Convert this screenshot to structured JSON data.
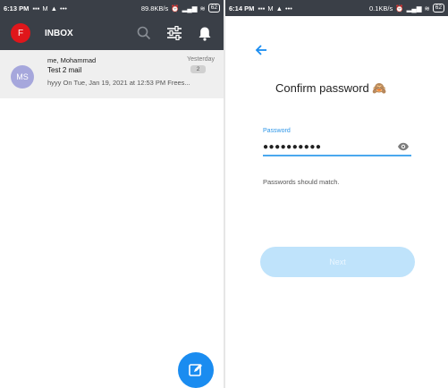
{
  "left": {
    "status": {
      "time": "6:13 PM",
      "speed": "89.8KB/s",
      "battery": "62"
    },
    "header": {
      "avatar": "F",
      "title": "INBOX"
    },
    "mail": {
      "avatar": "MS",
      "from": "me, Mohammad",
      "date": "Yesterday",
      "subject": "Test 2 mail",
      "count": "2",
      "snippet": "hyyy On Tue, Jan 19, 2021 at 12:53 PM Frees..."
    }
  },
  "right": {
    "status": {
      "time": "6:14 PM",
      "speed": "0.1KB/s",
      "battery": "62"
    },
    "heading": "Confirm password 🙈",
    "password": {
      "label": "Password",
      "value": "●●●●●●●●●●"
    },
    "hint": "Passwords should match.",
    "next_label": "Next"
  },
  "colors": {
    "appbar": "#3a3f47",
    "accent": "#1a8cf0",
    "avatar_f": "#e0161b",
    "avatar_ms": "#a6a7dc",
    "next_disabled": "#bfe3fb"
  }
}
